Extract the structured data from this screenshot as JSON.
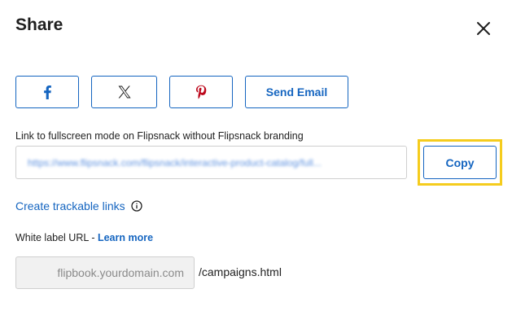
{
  "dialog": {
    "title": "Share"
  },
  "share_buttons": {
    "facebook_icon": "facebook-icon",
    "x_icon": "x-twitter-icon",
    "pinterest_icon": "pinterest-icon",
    "email_label": "Send Email"
  },
  "fullscreen_link": {
    "label": "Link to fullscreen mode on Flipsnack without Flipsnack branding",
    "url": "https://www.flipsnack.com/flipsnack/interactive-product-catalog/full...",
    "copy_label": "Copy"
  },
  "trackable": {
    "link_label": "Create trackable links",
    "info_icon": "info-icon"
  },
  "white_label": {
    "label": "White label URL - ",
    "learn_more": "Learn more",
    "domain_placeholder": "flipbook.yourdomain.com",
    "path": "/campaigns.html"
  },
  "colors": {
    "accent": "#1565c0",
    "highlight": "#f5cc1d",
    "pinterest": "#bd081c",
    "facebook": "#1565c0"
  }
}
